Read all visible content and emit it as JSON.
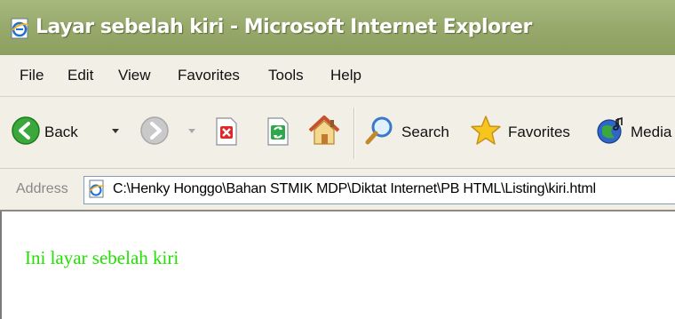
{
  "window": {
    "title": "Layar sebelah kiri - Microsoft Internet Explorer"
  },
  "menu": {
    "items": [
      "File",
      "Edit",
      "View",
      "Favorites",
      "Tools",
      "Help"
    ]
  },
  "toolbar": {
    "back_label": "Back",
    "search_label": "Search",
    "favorites_label": "Favorites",
    "media_label": "Media"
  },
  "address": {
    "label": "Address",
    "value": "C:\\Henky Honggo\\Bahan STMIK MDP\\Diktat Internet\\PB HTML\\Listing\\kiri.html"
  },
  "content": {
    "text": "Ini layar sebelah kiri",
    "text_color": "#22e000"
  },
  "icons": {
    "app": "ie-page-icon",
    "back": "back-arrow-icon",
    "forward": "forward-arrow-icon",
    "stop": "stop-icon",
    "refresh": "refresh-icon",
    "home": "home-icon",
    "search": "search-icon",
    "favorites": "favorites-star-icon",
    "media": "media-icon"
  }
}
